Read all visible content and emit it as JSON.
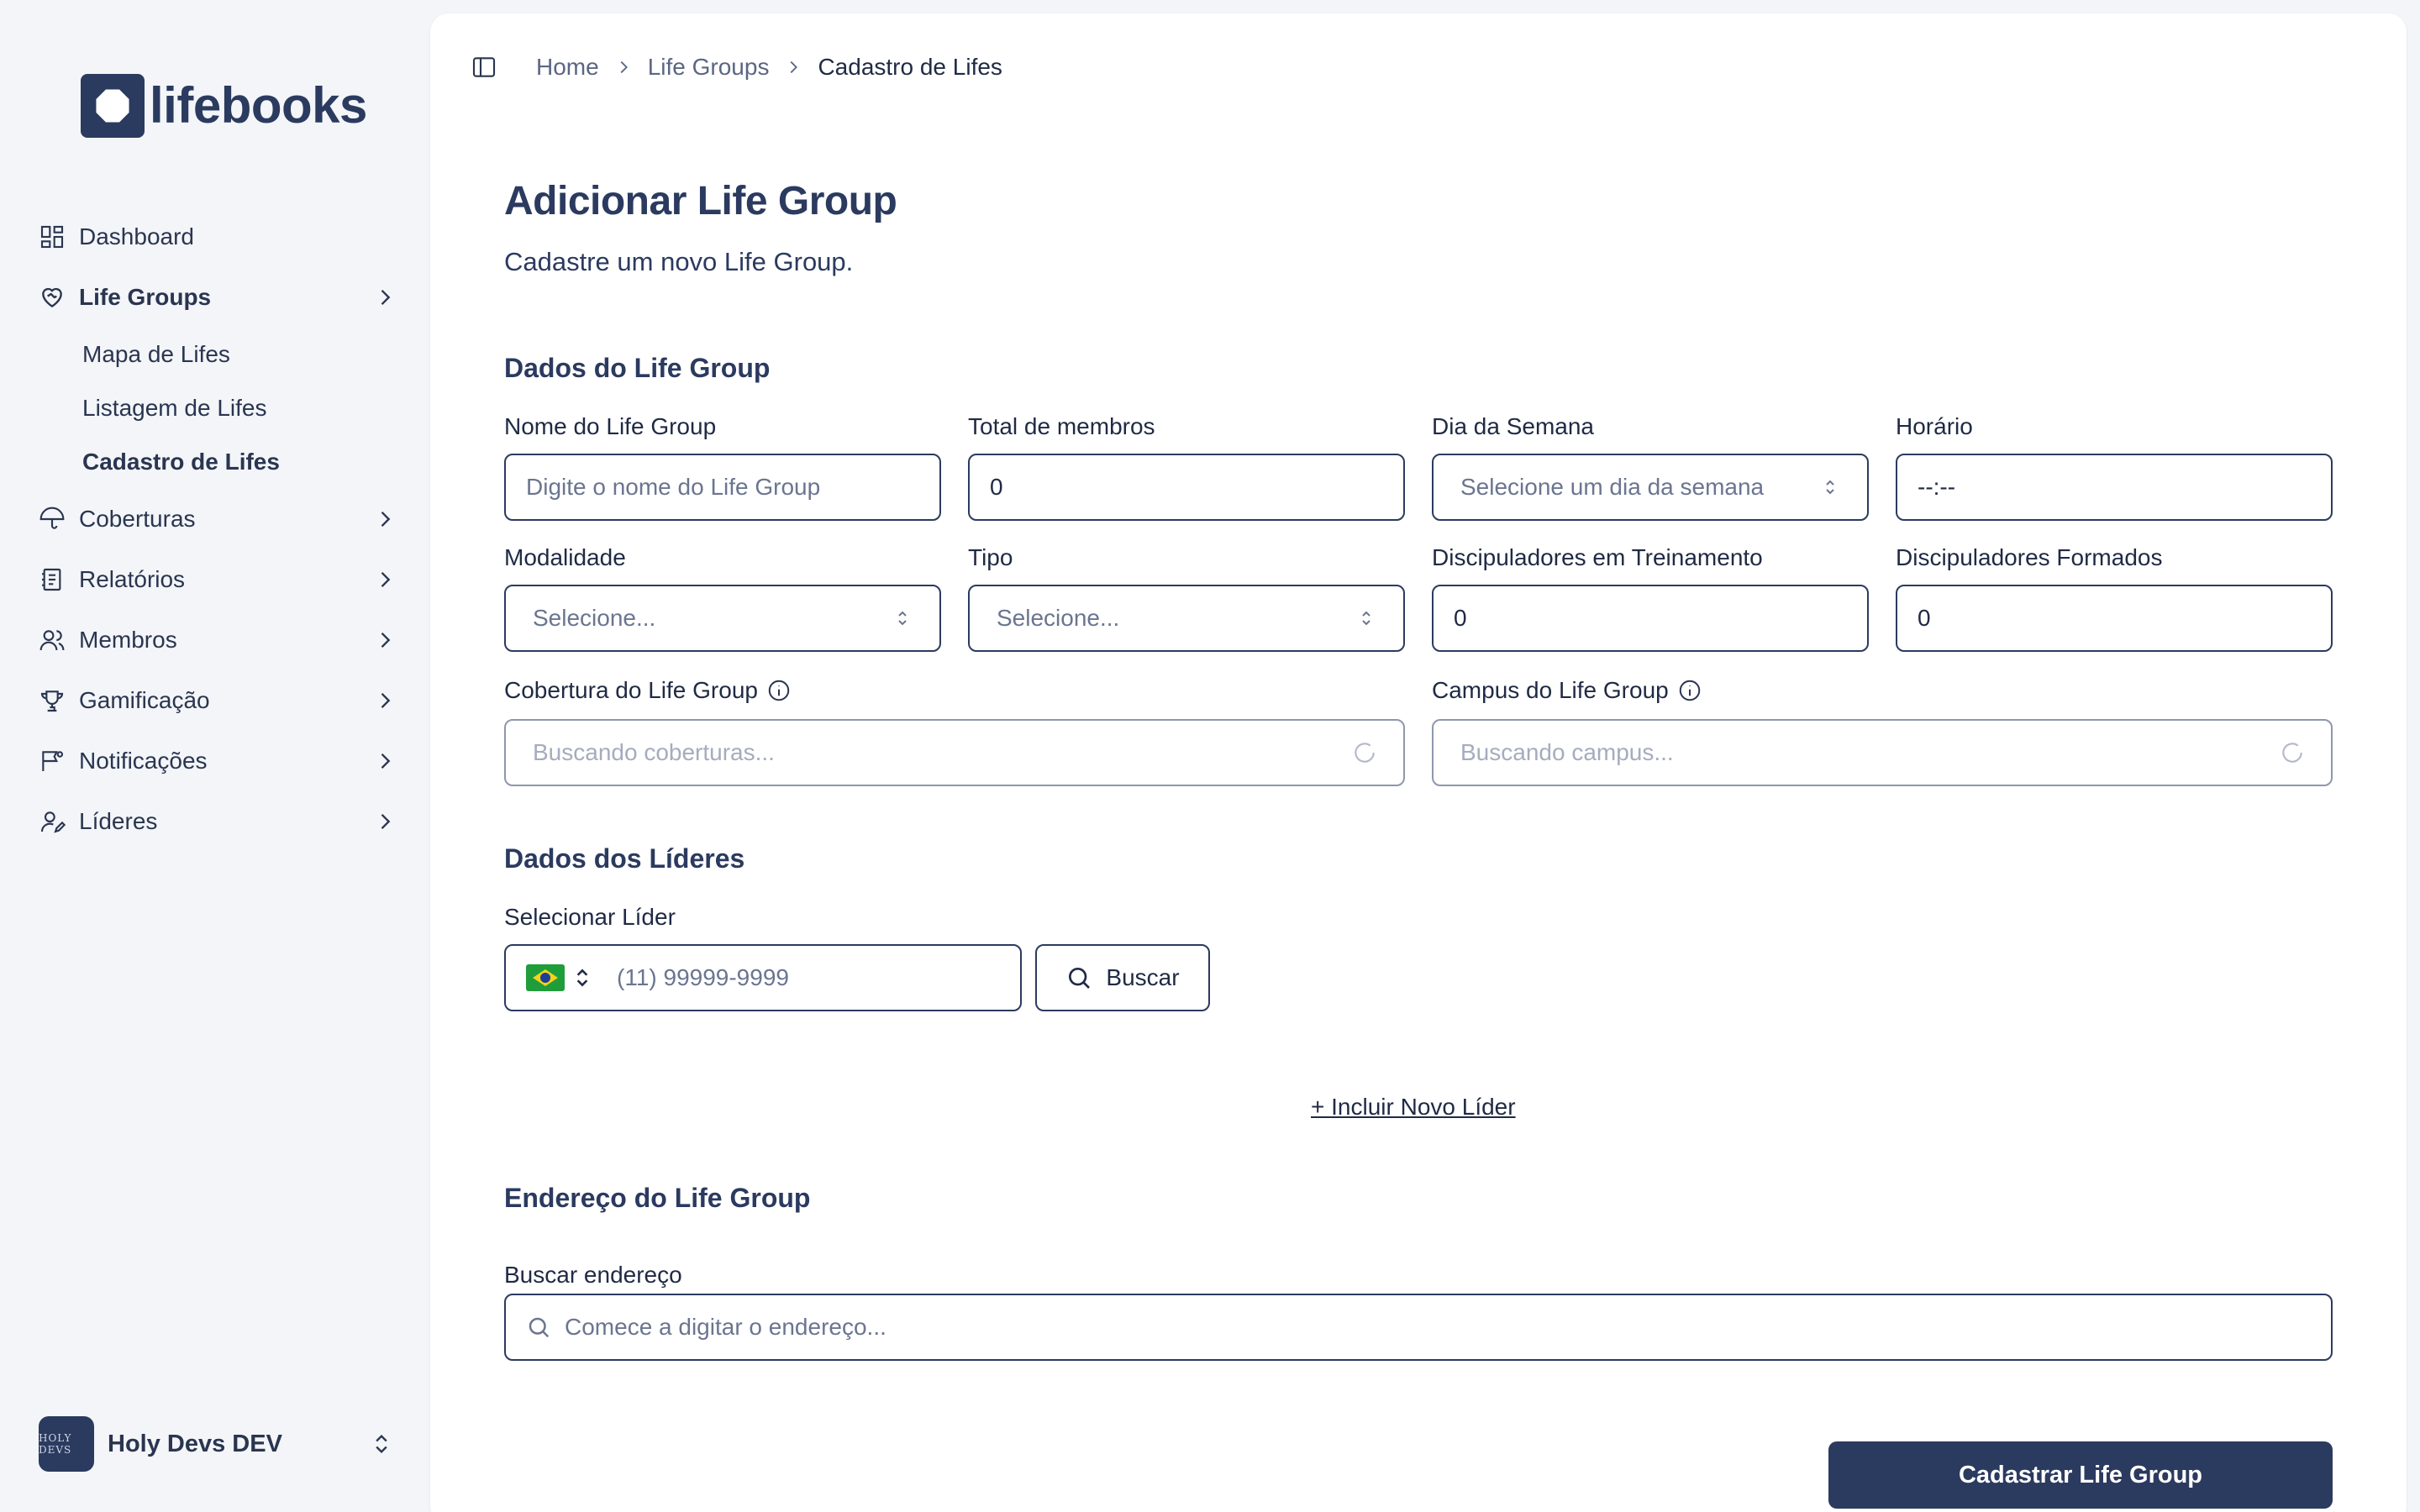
{
  "app": {
    "logo_text": "lifebooks"
  },
  "sidebar": {
    "items": [
      {
        "label": "Dashboard"
      },
      {
        "label": "Life Groups"
      },
      {
        "label": "Coberturas"
      },
      {
        "label": "Relatórios"
      },
      {
        "label": "Membros"
      },
      {
        "label": "Gamificação"
      },
      {
        "label": "Notificações"
      },
      {
        "label": "Líderes"
      }
    ],
    "life_groups_sub": [
      {
        "label": "Mapa de Lifes"
      },
      {
        "label": "Listagem de Lifes"
      },
      {
        "label": "Cadastro de Lifes"
      }
    ],
    "workspace": {
      "name": "Holy Devs DEV",
      "avatar_text": "HOLY DEVS"
    }
  },
  "breadcrumb": [
    "Home",
    "Life Groups",
    "Cadastro de Lifes"
  ],
  "page": {
    "title": "Adicionar Life Group",
    "subtitle": "Cadastre um novo Life Group."
  },
  "group_section": {
    "title": "Dados do Life Group",
    "name": {
      "label": "Nome do Life Group",
      "placeholder": "Digite o nome do Life Group"
    },
    "members": {
      "label": "Total de membros",
      "value": "0"
    },
    "weekday": {
      "label": "Dia da Semana",
      "value": "Selecione um dia da semana"
    },
    "time": {
      "label": "Horário",
      "value": "--:--"
    },
    "modality": {
      "label": "Modalidade",
      "value": "Selecione..."
    },
    "type": {
      "label": "Tipo",
      "value": "Selecione..."
    },
    "disc_training": {
      "label": "Discipuladores em Treinamento",
      "value": "0"
    },
    "disc_formed": {
      "label": "Discipuladores Formados",
      "value": "0"
    },
    "coverage": {
      "label": "Cobertura do Life Group",
      "value": "Buscando coberturas..."
    },
    "campus": {
      "label": "Campus do Life Group",
      "value": "Buscando campus..."
    }
  },
  "leaders_section": {
    "title": "Dados dos Líderes",
    "select_label": "Selecionar Líder",
    "phone_placeholder": "(11) 99999-9999",
    "search_button": "Buscar",
    "add_new": "+ Incluir Novo Líder"
  },
  "address_section": {
    "title": "Endereço do Life Group",
    "search_label": "Buscar endereço",
    "search_placeholder": "Comece a digitar o endereço..."
  },
  "submit_label": "Cadastrar Life Group",
  "colors": {
    "brand": "#2b3a5f",
    "flag_green": "#1f9d3a",
    "flag_yellow": "#f2d21b",
    "flag_blue": "#1c3f94"
  }
}
